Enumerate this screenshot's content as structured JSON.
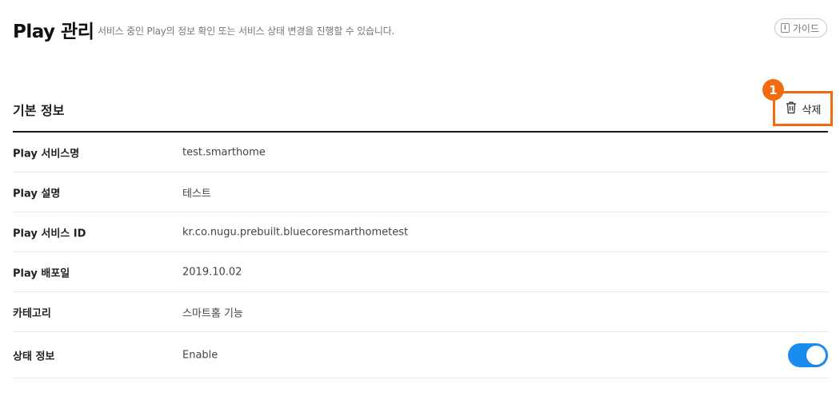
{
  "header": {
    "title": "Play 관리",
    "description": "서비스 중인 Play의 정보 확인 또는 서비스 상태 변경을 진행할 수 있습니다.",
    "guide_label": "가이드",
    "guide_icon": "info-icon"
  },
  "section": {
    "title": "기본 정보",
    "delete_label": "삭제",
    "delete_icon": "trash-icon",
    "callout_number": "1",
    "accent_color": "#f26b0f"
  },
  "rows": [
    {
      "label": "Play 서비스명",
      "value": "test.smarthome"
    },
    {
      "label": "Play 설명",
      "value": "테스트"
    },
    {
      "label": "Play 서비스 ID",
      "value": "kr.co.nugu.prebuilt.bluecoresmarthometest"
    },
    {
      "label": "Play 배포일",
      "value": "2019.10.02"
    },
    {
      "label": "카테고리",
      "value": "스마트홈 기능"
    },
    {
      "label": "상태 정보",
      "value": "Enable",
      "toggle_on": true,
      "toggle_color": "#1a8cf0"
    }
  ]
}
